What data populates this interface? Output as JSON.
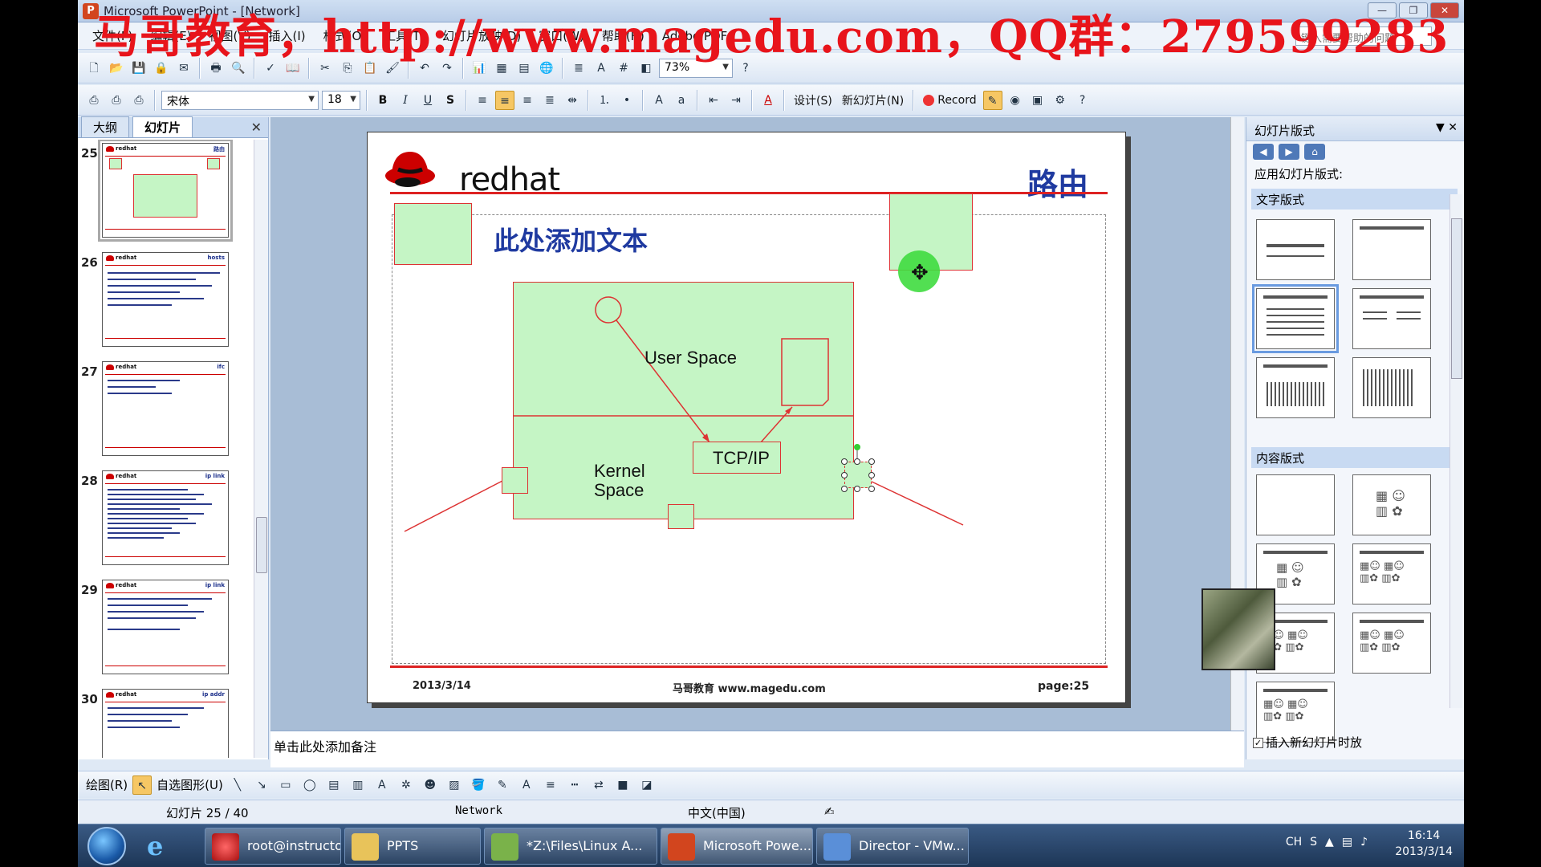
{
  "window": {
    "title": "Microsoft PowerPoint - [Network]"
  },
  "watermark": "马哥教育，http://www.magedu.com，QQ群：279599283",
  "menu": [
    "文件(F)",
    "编辑(E)",
    "视图(V)",
    "插入(I)",
    "格式(O)",
    "工具(T)",
    "幻灯片放映(D)",
    "窗口(W)",
    "帮助(H)",
    "Adobe PDF"
  ],
  "help_placeholder": "键入需要帮助的问题",
  "toolbar": {
    "zoom": "73%",
    "font": "宋体",
    "font_size": "18",
    "bold": "B",
    "italic": "I",
    "underline": "U",
    "shadow": "S",
    "design": "设计(S)",
    "new_slide": "新幻灯片(N)",
    "record": "Record"
  },
  "left_pane": {
    "tabs": [
      "大纲",
      "幻灯片"
    ],
    "thumbnails": [
      {
        "num": "25",
        "title": "路由"
      },
      {
        "num": "26",
        "title": "hosts"
      },
      {
        "num": "27",
        "title": "ifc"
      },
      {
        "num": "28",
        "title": "ip link"
      },
      {
        "num": "29",
        "title": "ip link"
      },
      {
        "num": "30",
        "title": "ip addr"
      }
    ]
  },
  "slide": {
    "brand": "redhat",
    "title": "路由",
    "placeholder": "此处添加文本",
    "user_space": "User Space",
    "kernel_space_1": "Kernel",
    "kernel_space_2": "Space",
    "tcpip": "TCP/IP",
    "footer_date": "2013/3/14",
    "footer_site": "马哥教育 www.magedu.com",
    "footer_page": "page:25"
  },
  "notes_placeholder": "单击此处添加备注",
  "task_pane": {
    "title": "幻灯片版式",
    "apply_label": "应用幻灯片版式:",
    "section_text": "文字版式",
    "section_content": "内容版式",
    "insert_check": "插入新幻灯片时放"
  },
  "drawbar": {
    "draw": "绘图(R)",
    "autoshape": "自选图形(U)"
  },
  "status": {
    "slide_count": "幻灯片 25 / 40",
    "template": "Network",
    "language": "中文(中国)"
  },
  "taskbar": {
    "items": [
      "root@instructor:...",
      "PPTS",
      "*Z:\\Files\\Linux A...",
      "Microsoft Powe...",
      "Director - VMw..."
    ],
    "lang": "CH",
    "time": "16:14",
    "date": "2013/3/14"
  },
  "colors": {
    "accent_red": "#d22222",
    "box_green": "#c5f5c5",
    "title_blue": "#1f3aa0"
  }
}
